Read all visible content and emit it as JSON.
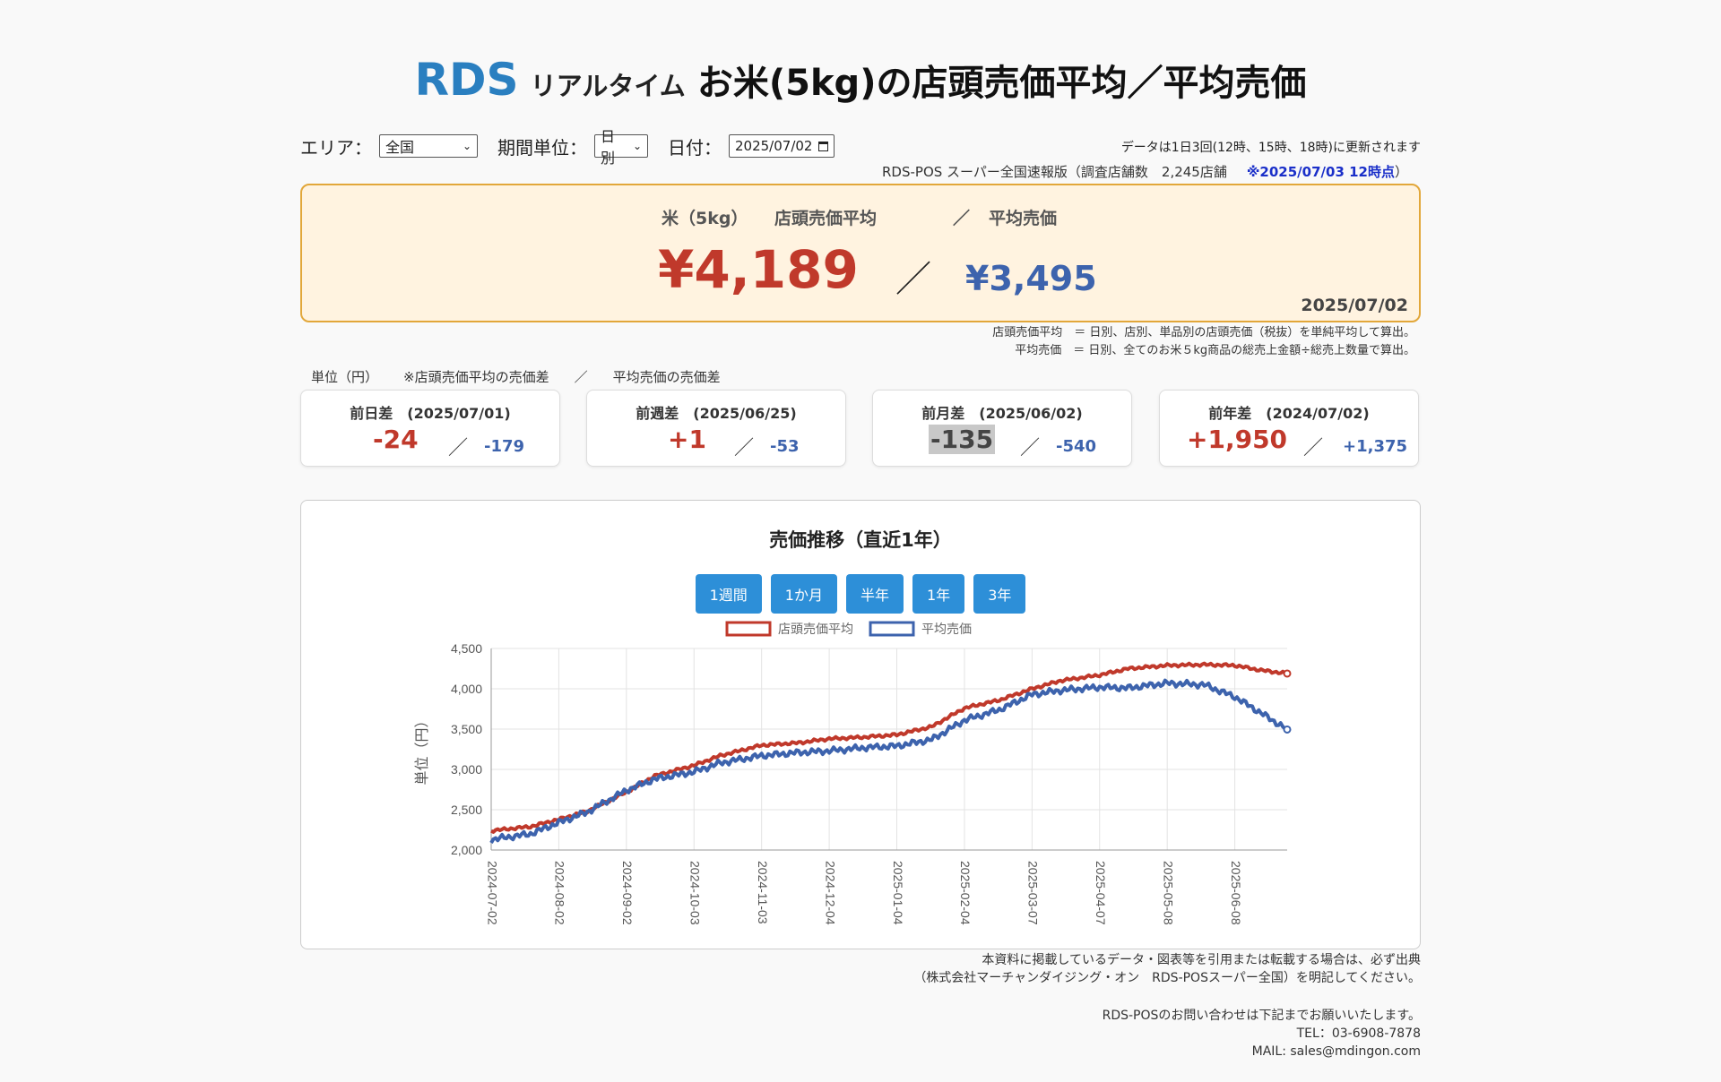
{
  "header": {
    "brand": "RDS",
    "realtime": "リアルタイム",
    "title": "お米(5kg)の店頭売価平均／平均売価"
  },
  "controls": {
    "area_label": "エリア：",
    "area_value": "全国",
    "period_label": "期間単位：",
    "period_value": "日別",
    "date_label": "日付：",
    "date_value": "2025/07/02",
    "update_note": "データは1日3回(12時、15時、18時)に更新されます",
    "survey": "RDS-POS スーパー全国速報版（調査店舗数　2,245店舗",
    "survey_time": "※2025/07/03 12時点",
    "survey_close": "）"
  },
  "summary": {
    "head_item": "米（5kg）",
    "head_avg": "店頭売価平均",
    "head_slash": "／",
    "head_mean": "平均売価",
    "avg_price": "¥4,189",
    "slash": "／",
    "mean_price": "¥3,495",
    "date": "2025/07/02"
  },
  "definitions": {
    "line1": "店頭売価平均　＝ 日別、店別、単品別の店頭売価（税抜）を単純平均して算出。",
    "line2": "平均売価　＝ 日別、全てのお米５kg商品の総売上金額÷総売上数量で算出。"
  },
  "unit_row": {
    "unit": "単位（円）",
    "note1": "※店頭売価平均の売価差",
    "slash": "／",
    "note2": "平均売価の売価差"
  },
  "diffs": [
    {
      "title": "前日差　(2025/07/01)",
      "avg": "-24",
      "slash": "／",
      "mean": "-179"
    },
    {
      "title": "前週差　(2025/06/25)",
      "avg": "+1",
      "slash": "／",
      "mean": "-53"
    },
    {
      "title": "前月差　(2025/06/02)",
      "avg": "-135",
      "slash": "／",
      "mean": "-540"
    },
    {
      "title": "前年差　(2024/07/02)",
      "avg": "+1,950",
      "slash": "／",
      "mean": "+1,375"
    }
  ],
  "chart_panel": {
    "title": "売価推移（直近1年）",
    "buttons": [
      "1週間",
      "1か月",
      "半年",
      "1年",
      "3年"
    ]
  },
  "chart_data": {
    "type": "line",
    "ylabel": "単位（円）",
    "ylim": [
      2000,
      4500
    ],
    "yticks": [
      "2,000",
      "2,500",
      "3,000",
      "3,500",
      "4,000",
      "4,500"
    ],
    "xticks": [
      "2024-07-02",
      "2024-08-02",
      "2024-09-02",
      "2024-10-03",
      "2024-11-03",
      "2024-12-04",
      "2025-01-04",
      "2025-02-04",
      "2025-03-07",
      "2025-04-07",
      "2025-05-08",
      "2025-06-08"
    ],
    "x_range": [
      "2024-07-02",
      "2025-07-02"
    ],
    "grid": true,
    "legend": "top",
    "series": [
      {
        "name": "店頭売価平均",
        "color": "#c0392b",
        "points": [
          [
            "2024-07-02",
            2240
          ],
          [
            "2024-07-20",
            2290
          ],
          [
            "2024-08-02",
            2380
          ],
          [
            "2024-08-15",
            2480
          ],
          [
            "2024-09-02",
            2720
          ],
          [
            "2024-09-15",
            2920
          ],
          [
            "2024-10-03",
            3050
          ],
          [
            "2024-10-15",
            3170
          ],
          [
            "2024-11-03",
            3300
          ],
          [
            "2024-11-20",
            3330
          ],
          [
            "2024-12-04",
            3380
          ],
          [
            "2024-12-20",
            3400
          ],
          [
            "2025-01-04",
            3430
          ],
          [
            "2025-01-20",
            3530
          ],
          [
            "2025-02-04",
            3760
          ],
          [
            "2025-02-20",
            3860
          ],
          [
            "2025-03-07",
            4000
          ],
          [
            "2025-03-20",
            4100
          ],
          [
            "2025-04-07",
            4170
          ],
          [
            "2025-04-20",
            4250
          ],
          [
            "2025-05-08",
            4290
          ],
          [
            "2025-05-25",
            4300
          ],
          [
            "2025-06-08",
            4290
          ],
          [
            "2025-06-20",
            4230
          ],
          [
            "2025-07-02",
            4189
          ]
        ]
      },
      {
        "name": "平均売価",
        "color": "#3d63ad",
        "points": [
          [
            "2024-07-02",
            2130
          ],
          [
            "2024-07-20",
            2200
          ],
          [
            "2024-08-02",
            2340
          ],
          [
            "2024-08-15",
            2470
          ],
          [
            "2024-09-02",
            2740
          ],
          [
            "2024-09-15",
            2880
          ],
          [
            "2024-10-03",
            2970
          ],
          [
            "2024-10-15",
            3080
          ],
          [
            "2024-11-03",
            3170
          ],
          [
            "2024-11-20",
            3210
          ],
          [
            "2024-12-04",
            3230
          ],
          [
            "2024-12-20",
            3270
          ],
          [
            "2025-01-04",
            3290
          ],
          [
            "2025-01-20",
            3370
          ],
          [
            "2025-02-04",
            3610
          ],
          [
            "2025-02-20",
            3740
          ],
          [
            "2025-03-07",
            3930
          ],
          [
            "2025-03-20",
            3980
          ],
          [
            "2025-04-07",
            4020
          ],
          [
            "2025-04-20",
            4010
          ],
          [
            "2025-05-08",
            4070
          ],
          [
            "2025-05-25",
            4050
          ],
          [
            "2025-06-08",
            3900
          ],
          [
            "2025-06-20",
            3700
          ],
          [
            "2025-07-02",
            3495
          ]
        ]
      }
    ]
  },
  "footer": {
    "cite1": "本資料に掲載しているデータ・図表等を引用または転載する場合は、必ず出典",
    "cite2": "（株式会社マーチャンダイジング・オン　RDS-POSスーパー全国）を明記してください。",
    "contact1": "RDS-POSのお問い合わせは下記までお願いいたします。",
    "contact2": "TEL：03-6908-7878",
    "contact3": "MAIL: sales@mdingon.com"
  }
}
